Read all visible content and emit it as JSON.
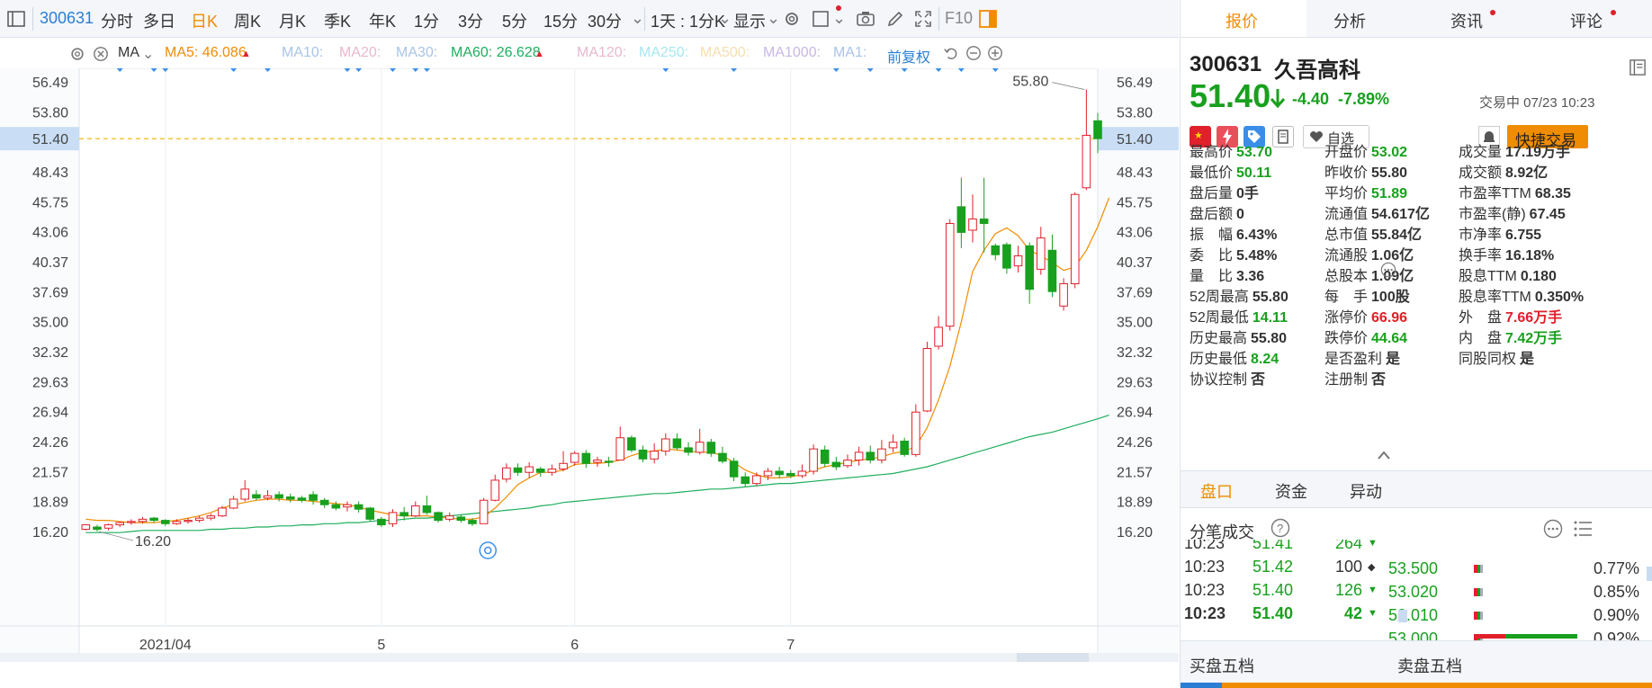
{
  "toolbar": {
    "stock_code": "300631",
    "periods": [
      "分时",
      "多日",
      "日K",
      "周K",
      "月K",
      "季K",
      "年K",
      "1分",
      "3分",
      "5分",
      "15分",
      "30分"
    ],
    "active_period": "日K",
    "period_combo": "1天 : 1分K",
    "display_label": "显示",
    "f10_label": "F10"
  },
  "ma_row": {
    "ma_label": "MA",
    "ma5": "MA5: 46.086",
    "ma10": "MA10:",
    "ma20": "MA20:",
    "ma30": "MA30:",
    "ma60": "MA60: 26.628",
    "ma120": "MA120:",
    "ma250": "MA250:",
    "ma500": "MA500:",
    "ma1000": "MA1000:",
    "ma1": "MA1:",
    "adjust_label": "前复权",
    "colors": {
      "ma5": "#f08c00",
      "ma60": "#1fae5e",
      "faded": "#a9c4e8"
    }
  },
  "chart_data": {
    "type": "candlestick",
    "current_price_label": "51.40",
    "y_ticks": [
      "56.49",
      "53.80",
      "51.40",
      "48.43",
      "45.75",
      "43.06",
      "40.37",
      "37.69",
      "35.00",
      "32.32",
      "29.63",
      "26.94",
      "24.26",
      "21.57",
      "18.89",
      "16.20"
    ],
    "y_tick_values": [
      56.49,
      53.8,
      51.4,
      48.43,
      45.75,
      43.06,
      40.37,
      37.69,
      35.0,
      32.32,
      29.63,
      26.94,
      24.26,
      21.57,
      18.89,
      16.2
    ],
    "x_labels": [
      {
        "label": "2021/04",
        "index": 7
      },
      {
        "label": "5",
        "index": 26
      },
      {
        "label": "6",
        "index": 43
      },
      {
        "label": "7",
        "index": 62
      }
    ],
    "high_annotation": "55.80",
    "low_annotation": "16.20",
    "ylim": [
      14.5,
      58.5
    ],
    "candles": [
      [
        16.4,
        16.8,
        16.3,
        16.6
      ],
      [
        16.6,
        16.4,
        16.2,
        16.8
      ],
      [
        16.5,
        16.8,
        16.3,
        16.9
      ],
      [
        16.8,
        17.0,
        16.6,
        17.1
      ],
      [
        17.0,
        17.1,
        16.8,
        17.3
      ],
      [
        17.1,
        17.3,
        16.9,
        17.5
      ],
      [
        17.4,
        17.2,
        17.0,
        17.5
      ],
      [
        17.2,
        16.9,
        16.7,
        17.3
      ],
      [
        16.9,
        17.1,
        16.8,
        17.3
      ],
      [
        17.1,
        17.2,
        16.9,
        17.4
      ],
      [
        17.2,
        17.4,
        17.0,
        17.6
      ],
      [
        17.4,
        17.6,
        17.2,
        17.8
      ],
      [
        17.6,
        18.3,
        17.5,
        18.5
      ],
      [
        18.3,
        19.1,
        18.2,
        19.4
      ],
      [
        19.1,
        20.0,
        18.9,
        20.8
      ],
      [
        19.5,
        19.2,
        19.0,
        19.9
      ],
      [
        19.2,
        19.4,
        19.0,
        19.9
      ],
      [
        19.5,
        19.2,
        18.9,
        19.8
      ],
      [
        19.3,
        19.1,
        18.8,
        19.6
      ],
      [
        19.2,
        19.0,
        18.8,
        19.4
      ],
      [
        19.5,
        19.0,
        18.6,
        19.8
      ],
      [
        19.0,
        18.6,
        18.3,
        19.2
      ],
      [
        18.6,
        18.3,
        18.1,
        18.9
      ],
      [
        18.4,
        18.6,
        18.0,
        18.9
      ],
      [
        18.6,
        18.2,
        17.9,
        18.9
      ],
      [
        18.3,
        17.3,
        17.1,
        18.4
      ],
      [
        17.3,
        16.8,
        16.6,
        17.5
      ],
      [
        16.9,
        17.9,
        16.6,
        18.2
      ],
      [
        17.9,
        17.6,
        17.2,
        18.4
      ],
      [
        17.6,
        18.5,
        17.5,
        18.9
      ],
      [
        18.5,
        17.9,
        17.7,
        19.4
      ],
      [
        17.9,
        17.2,
        17.0,
        18.0
      ],
      [
        17.3,
        17.6,
        17.1,
        17.9
      ],
      [
        17.5,
        17.2,
        17.0,
        17.7
      ],
      [
        17.2,
        16.9,
        16.7,
        17.4
      ],
      [
        16.9,
        19.0,
        16.9,
        19.2
      ],
      [
        19.0,
        20.8,
        18.9,
        21.3
      ],
      [
        20.9,
        21.9,
        20.6,
        22.3
      ],
      [
        21.9,
        21.5,
        21.2,
        22.3
      ],
      [
        21.5,
        22.0,
        21.0,
        22.4
      ],
      [
        21.8,
        21.5,
        21.1,
        22.0
      ],
      [
        21.5,
        21.8,
        21.2,
        22.2
      ],
      [
        21.8,
        22.3,
        21.6,
        23.4
      ],
      [
        22.4,
        23.2,
        22.1,
        23.4
      ],
      [
        23.2,
        22.3,
        21.9,
        23.5
      ],
      [
        22.4,
        22.6,
        22.0,
        22.9
      ],
      [
        22.5,
        22.4,
        22.0,
        22.9
      ],
      [
        22.6,
        24.6,
        22.6,
        25.6
      ],
      [
        24.6,
        23.5,
        23.3,
        24.8
      ],
      [
        23.5,
        22.7,
        22.4,
        23.9
      ],
      [
        22.7,
        23.4,
        22.3,
        24.1
      ],
      [
        23.4,
        24.5,
        23.0,
        25.0
      ],
      [
        24.5,
        23.7,
        23.5,
        25.0
      ],
      [
        23.7,
        23.3,
        23.0,
        24.2
      ],
      [
        23.3,
        24.2,
        23.1,
        25.4
      ],
      [
        24.2,
        23.2,
        22.9,
        24.5
      ],
      [
        23.2,
        22.5,
        22.3,
        23.8
      ],
      [
        22.5,
        21.1,
        20.7,
        22.8
      ],
      [
        21.1,
        20.5,
        20.2,
        21.5
      ],
      [
        20.5,
        21.2,
        20.3,
        21.5
      ],
      [
        21.2,
        21.6,
        20.8,
        21.9
      ],
      [
        21.6,
        21.3,
        21.0,
        22.0
      ],
      [
        21.4,
        21.2,
        21.0,
        21.7
      ],
      [
        21.2,
        21.6,
        21.0,
        22.2
      ],
      [
        21.6,
        23.6,
        21.3,
        24.0
      ],
      [
        23.5,
        22.3,
        22.0,
        23.9
      ],
      [
        22.4,
        22.0,
        21.7,
        22.9
      ],
      [
        22.1,
        22.6,
        21.9,
        23.1
      ],
      [
        22.6,
        23.3,
        22.1,
        23.8
      ],
      [
        23.3,
        22.6,
        22.3,
        23.9
      ],
      [
        22.6,
        23.6,
        22.3,
        24.4
      ],
      [
        23.7,
        24.2,
        23.3,
        24.9
      ],
      [
        24.3,
        23.1,
        22.9,
        24.6
      ],
      [
        23.1,
        26.9,
        22.9,
        27.6
      ],
      [
        27.0,
        32.6,
        26.9,
        33.2
      ],
      [
        32.8,
        34.5,
        32.5,
        35.5
      ],
      [
        34.6,
        43.8,
        34.2,
        44.2
      ],
      [
        45.3,
        43.0,
        41.6,
        47.9
      ],
      [
        43.2,
        44.2,
        42.1,
        46.4
      ],
      [
        44.2,
        43.8,
        41.2,
        47.9
      ],
      [
        41.8,
        41.0,
        40.5,
        42.0
      ],
      [
        41.9,
        39.8,
        39.3,
        42.1
      ],
      [
        40.0,
        40.9,
        39.4,
        41.8
      ],
      [
        41.8,
        37.9,
        36.6,
        42.1
      ],
      [
        39.7,
        42.5,
        39.2,
        43.5
      ],
      [
        41.4,
        37.7,
        37.2,
        42.8
      ],
      [
        36.4,
        38.4,
        36.0,
        38.9
      ],
      [
        38.4,
        46.4,
        38.0,
        46.6
      ],
      [
        47.0,
        51.7,
        46.8,
        55.8
      ],
      [
        53.0,
        51.4,
        50.1,
        53.7
      ]
    ],
    "ma5_line": [
      17.3,
      17.2,
      17.2,
      17.1,
      17.0,
      17.0,
      17.0,
      17.1,
      17.2,
      17.4,
      17.6,
      17.9,
      18.3,
      18.6,
      18.8,
      19.0,
      19.1,
      19.1,
      19.0,
      19.0,
      18.9,
      18.8,
      18.7,
      18.6,
      18.4,
      18.1,
      17.9,
      17.7,
      17.6,
      17.6,
      17.6,
      17.5,
      17.4,
      17.3,
      17.3,
      17.5,
      18.3,
      19.3,
      20.4,
      21.0,
      21.5,
      21.5,
      21.7,
      22.2,
      22.3,
      22.3,
      22.4,
      22.6,
      23.0,
      23.3,
      23.4,
      23.6,
      23.5,
      23.4,
      23.3,
      23.3,
      23.0,
      22.4,
      21.7,
      21.3,
      21.0,
      21.0,
      21.1,
      21.3,
      21.7,
      22.0,
      22.2,
      22.4,
      22.6,
      22.7,
      22.9,
      23.2,
      23.4,
      23.8,
      25.5,
      28.0,
      31.0,
      35.0,
      39.5,
      41.4,
      42.9,
      43.4,
      42.7,
      41.4,
      40.9,
      40.3,
      39.6,
      39.9,
      41.4,
      43.5,
      46.1
    ],
    "ma60_line": [
      16.1,
      16.1,
      16.1,
      16.1,
      16.2,
      16.3,
      16.3,
      16.3,
      16.3,
      16.3,
      16.3,
      16.4,
      16.4,
      16.5,
      16.5,
      16.6,
      16.6,
      16.7,
      16.7,
      16.8,
      16.8,
      16.9,
      16.9,
      17.0,
      17.0,
      17.1,
      17.2,
      17.2,
      17.3,
      17.4,
      17.4,
      17.5,
      17.6,
      17.7,
      17.8,
      17.9,
      18.0,
      18.1,
      18.2,
      18.3,
      18.5,
      18.6,
      18.8,
      18.9,
      19.0,
      19.1,
      19.2,
      19.3,
      19.4,
      19.5,
      19.6,
      19.6,
      19.7,
      19.8,
      19.9,
      20.0,
      20.0,
      20.1,
      20.2,
      20.3,
      20.4,
      20.5,
      20.5,
      20.6,
      20.7,
      20.8,
      20.9,
      21.0,
      21.1,
      21.2,
      21.3,
      21.4,
      21.6,
      21.8,
      22.0,
      22.3,
      22.6,
      22.9,
      23.2,
      23.5,
      23.8,
      24.1,
      24.4,
      24.7,
      24.9,
      25.1,
      25.4,
      25.7,
      26.0,
      26.3,
      26.628
    ]
  },
  "quote": {
    "tabs": [
      "报价",
      "分析",
      "资讯",
      "评论"
    ],
    "active_tab": "报价",
    "code": "300631",
    "name": "久吾高科",
    "price": "51.40",
    "change": "-4.40",
    "change_pct": "-7.89%",
    "status": "交易中 07/23 10:23",
    "watch_label": "自选",
    "trade_label": "快捷交易",
    "fields": [
      {
        "label": "最高价",
        "value": "53.70",
        "cls": "down"
      },
      {
        "label": "开盘价",
        "value": "53.02",
        "cls": "down"
      },
      {
        "label": "成交量",
        "value": "17.19万手",
        "cls": ""
      },
      {
        "label": "最低价",
        "value": "50.11",
        "cls": "down"
      },
      {
        "label": "昨收价",
        "value": "55.80",
        "cls": ""
      },
      {
        "label": "成交额",
        "value": "8.92亿",
        "cls": ""
      },
      {
        "label": "盘后量",
        "value": "0手",
        "cls": ""
      },
      {
        "label": "平均价",
        "value": "51.89",
        "cls": "down"
      },
      {
        "label": "市盈率TTM",
        "value": "68.35",
        "cls": ""
      },
      {
        "label": "盘后额",
        "value": "0",
        "cls": ""
      },
      {
        "label": "流通值",
        "value": "54.617亿",
        "cls": ""
      },
      {
        "label": "市盈率(静)",
        "value": "67.45",
        "cls": ""
      },
      {
        "label": "振　幅",
        "value": "6.43%",
        "cls": ""
      },
      {
        "label": "总市值",
        "value": "55.84亿",
        "cls": ""
      },
      {
        "label": "市净率",
        "value": "6.755",
        "cls": ""
      },
      {
        "label": "委　比",
        "value": "5.48%",
        "cls": ""
      },
      {
        "label": "流通股",
        "value": "1.06亿",
        "cls": ""
      },
      {
        "label": "换手率",
        "value": "16.18%",
        "cls": ""
      },
      {
        "label": "量　比",
        "value": "3.36",
        "cls": ""
      },
      {
        "label": "总股本",
        "value": "1.09亿",
        "cls": ""
      },
      {
        "label": "股息TTM",
        "value": "0.180",
        "cls": ""
      },
      {
        "label": "52周最高",
        "value": "55.80",
        "cls": ""
      },
      {
        "label": "每　手",
        "value": "100股",
        "cls": ""
      },
      {
        "label": "股息率TTM",
        "value": "0.350%",
        "cls": ""
      },
      {
        "label": "52周最低",
        "value": "14.11",
        "cls": "down"
      },
      {
        "label": "涨停价",
        "value": "66.96",
        "cls": "up"
      },
      {
        "label": "外　盘",
        "value": "7.66万手",
        "cls": "up"
      },
      {
        "label": "历史最高",
        "value": "55.80",
        "cls": ""
      },
      {
        "label": "跌停价",
        "value": "44.64",
        "cls": "down"
      },
      {
        "label": "内　盘",
        "value": "7.42万手",
        "cls": "down"
      },
      {
        "label": "历史最低",
        "value": "8.24",
        "cls": "down"
      },
      {
        "label": "是否盈利",
        "value": "是",
        "cls": ""
      },
      {
        "label": "同股同权",
        "value": "是",
        "cls": ""
      },
      {
        "label": "协议控制",
        "value": "否",
        "cls": ""
      },
      {
        "label": "注册制",
        "value": "否",
        "cls": ""
      }
    ]
  },
  "panel": {
    "subtabs": [
      "盘口",
      "资金",
      "异动"
    ],
    "active_subtab": "盘口",
    "trades_title": "分笔成交",
    "ticks": [
      {
        "time": "10:23",
        "price": "51.41",
        "vol": "264",
        "dir": "down"
      },
      {
        "time": "10:23",
        "price": "51.42",
        "vol": "100",
        "dir": "flat"
      },
      {
        "time": "10:23",
        "price": "51.40",
        "vol": "126",
        "dir": "down"
      },
      {
        "time": "10:23",
        "price": "51.40",
        "vol": "42",
        "dir": "down"
      }
    ],
    "levels": [
      {
        "price": "53.500",
        "pct": "0.77%"
      },
      {
        "price": "53.020",
        "pct": "0.85%"
      },
      {
        "price": "53.010",
        "pct": "0.90%"
      },
      {
        "price": "53.000",
        "pct": "0.92%"
      }
    ],
    "buy5_label": "买盘五档",
    "sell5_label": "卖盘五档"
  }
}
